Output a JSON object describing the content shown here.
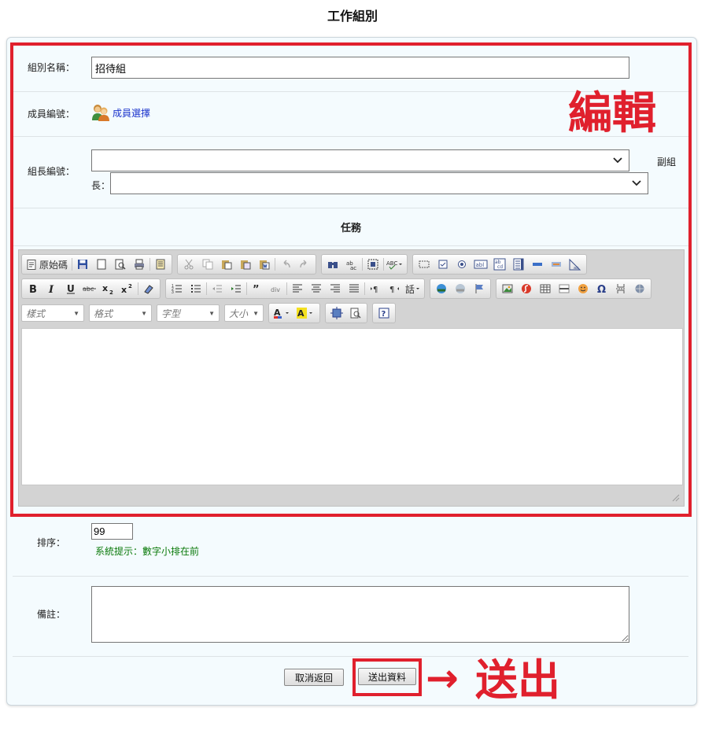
{
  "page": {
    "title": "工作組別"
  },
  "form": {
    "group_name": {
      "label": "組別名稱：",
      "value": "招待組"
    },
    "members": {
      "label": "成員編號：",
      "link": "成員選擇"
    },
    "leader": {
      "label": "組長編號：",
      "value": "",
      "vice_label_1": "副組",
      "vice_label_2": "長：",
      "vice_value": ""
    },
    "task": {
      "label": "任務"
    },
    "order": {
      "label": "排序：",
      "value": "99",
      "hint": "系統提示：數字小排在前"
    },
    "note": {
      "label": "備註：",
      "value": ""
    }
  },
  "editor": {
    "source_label": "原始碼",
    "combos": [
      "樣式",
      "格式",
      "字型",
      "大小"
    ]
  },
  "buttons": {
    "cancel": "取消返回",
    "submit": "送出資料"
  },
  "annotations": {
    "edit": "編輯",
    "arrow": "→",
    "submit": "送出",
    "color": "#e0202d"
  }
}
